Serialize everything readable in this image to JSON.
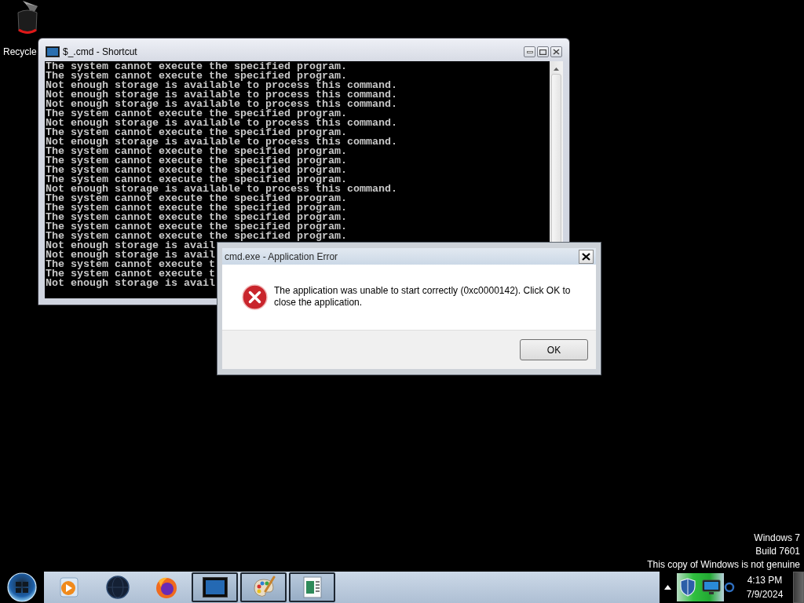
{
  "desktop": {
    "icons": [
      {
        "label": "Recycle"
      }
    ],
    "notice": [
      "Windows 7",
      "Build 7601",
      "This copy of Windows is not genuine"
    ]
  },
  "console_window": {
    "title": "$_.cmd - Shortcut",
    "lines": [
      "The system cannot execute the specified program.",
      "The system cannot execute the specified program.",
      "Not enough storage is available to process this command.",
      "Not enough storage is available to process this command.",
      "Not enough storage is available to process this command.",
      "The system cannot execute the specified program.",
      "Not enough storage is available to process this command.",
      "The system cannot execute the specified program.",
      "Not enough storage is available to process this command.",
      "The system cannot execute the specified program.",
      "The system cannot execute the specified program.",
      "The system cannot execute the specified program.",
      "The system cannot execute the specified program.",
      "Not enough storage is available to process this command.",
      "The system cannot execute the specified program.",
      "The system cannot execute the specified program.",
      "The system cannot execute the specified program.",
      "The system cannot execute the specified program.",
      "The system cannot execute the specified program.",
      "Not enough storage is avail",
      "Not enough storage is avail",
      "The system cannot execute t",
      "The system cannot execute t",
      "Not enough storage is avail"
    ]
  },
  "error_dialog": {
    "title": "cmd.exe - Application Error",
    "message": "The application was unable to start correctly (0xc0000142). Click OK to close the application.",
    "buttons": [
      "OK"
    ]
  },
  "taskbar": {
    "items": [
      {
        "kind": "player",
        "running": false
      },
      {
        "kind": "globe",
        "running": false
      },
      {
        "kind": "browser",
        "running": false
      },
      {
        "kind": "console",
        "running": true
      },
      {
        "kind": "paint",
        "running": true
      },
      {
        "kind": "document",
        "running": true
      }
    ],
    "clock": {
      "time": "4:13 PM",
      "date": "7/9/2024"
    }
  }
}
